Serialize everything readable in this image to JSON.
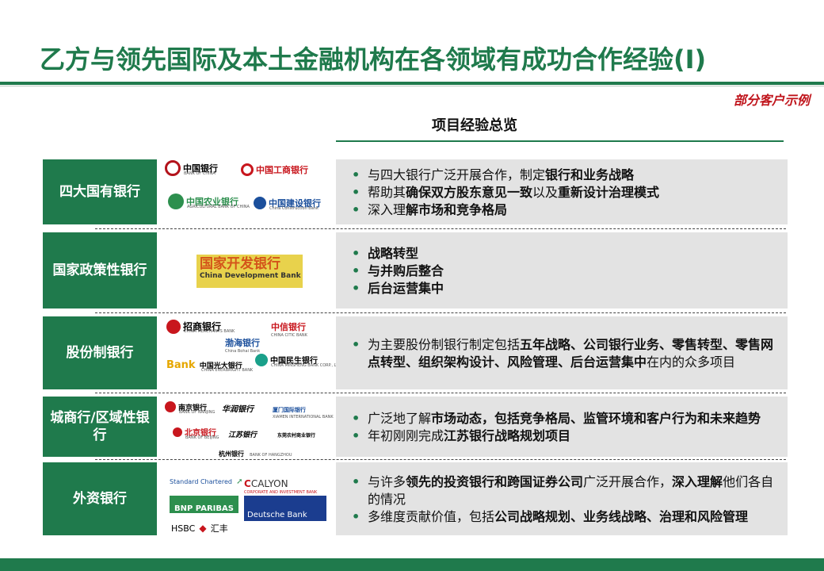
{
  "title": "乙方与领先国际及本土金融机构在各领域有成功合作经验(I)",
  "note": "部分客户示例",
  "section_title": "项目经验总览",
  "colors": {
    "green": "#1f7a4c",
    "red": "#c0151c",
    "panel": "#e3e3e3"
  },
  "rows": [
    {
      "label": "四大国有银行",
      "logos": [
        "中国银行",
        "BANK OF CHINA",
        "中国工商银行",
        "中国农业银行",
        "AGRICULTURAL BANK OF CHINA",
        "中国建设银行",
        "China Construction Bank"
      ],
      "bullets": [
        [
          {
            "t": "与四大银行广泛开展合作，制定",
            "b": false
          },
          {
            "t": "银行和业务战略",
            "b": true
          }
        ],
        [
          {
            "t": "帮助其",
            "b": false
          },
          {
            "t": "确保双方股东意见一致",
            "b": true
          },
          {
            "t": "以及",
            "b": false
          },
          {
            "t": "重新设计治理模式",
            "b": true
          }
        ],
        [
          {
            "t": "深入理",
            "b": false
          },
          {
            "t": "解市场和竞争格局",
            "b": true
          }
        ]
      ]
    },
    {
      "label": "国家政策性银行",
      "logos": [
        "国家开发银行",
        "China Development Bank"
      ],
      "bullets": [
        [
          {
            "t": "战略转型",
            "b": true
          }
        ],
        [
          {
            "t": "与并购后整合",
            "b": true
          }
        ],
        [
          {
            "t": "后台运营集中",
            "b": true
          }
        ]
      ]
    },
    {
      "label": "股份制银行",
      "logos": [
        "招商银行",
        "CHINA MERCHANTS BANK",
        "中信银行",
        "CHINA CITIC BANK",
        "渤海银行",
        "China Bohai Bank",
        "Bank",
        "中国光大银行",
        "CHINA EVERBRIGHT BANK",
        "中国民生银行",
        "CHINA MINSHENG BANK CORP., LTD."
      ],
      "bullets": [
        [
          {
            "t": "为主要股份制银行制定包括",
            "b": false
          },
          {
            "t": "五年战略、公司银行业务、零售转型、零售网点转型、组织架构设计、风险管理、后台运营集中",
            "b": true
          },
          {
            "t": "在内的众多项目",
            "b": false
          }
        ]
      ]
    },
    {
      "label": "城商行/区域性银行",
      "logos": [
        "南京银行",
        "BANK OF NANJING",
        "华润银行",
        "厦门国际银行",
        "XIAMEN INTERNATIONAL BANK",
        "北京银行",
        "BANK OF BEIJING",
        "江苏银行",
        "东莞农村商业银行",
        "杭州银行",
        "BANK OF HANGZHOU"
      ],
      "bullets": [
        [
          {
            "t": "广泛地了解",
            "b": false
          },
          {
            "t": "市场动态，包括竞争格局、监管环境和客户行为和未来趋势",
            "b": true
          }
        ],
        [
          {
            "t": "年初刚刚完成",
            "b": false
          },
          {
            "t": "江苏银行战略规划项目",
            "b": true
          }
        ]
      ]
    },
    {
      "label": "外资银行",
      "logos": [
        "Standard Chartered",
        "CALYON",
        "CORPORATE AND INVESTMENT BANK",
        "BNP PARIBAS",
        "Deutsche Bank",
        "HSBC",
        "汇丰"
      ],
      "bullets": [
        [
          {
            "t": "与许多",
            "b": false
          },
          {
            "t": "领先的投资银行和跨国证券公司",
            "b": true
          },
          {
            "t": "广泛开展合作，",
            "b": false
          },
          {
            "t": "深入理解",
            "b": true
          },
          {
            "t": "他们各自的情况",
            "b": false
          }
        ],
        [
          {
            "t": "多维度贡献价值，包括",
            "b": false
          },
          {
            "t": "公司战略规划、业务线战略、治理和风险管理",
            "b": true
          }
        ]
      ]
    }
  ]
}
